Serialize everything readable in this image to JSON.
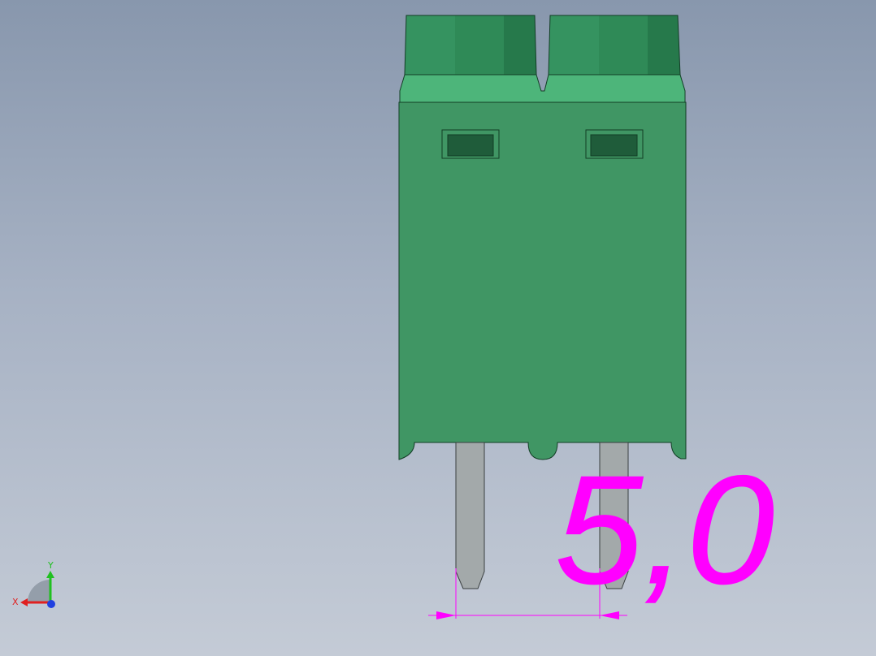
{
  "viewport": {
    "background_top": "#8897ad",
    "background_bottom": "#c4cbd6"
  },
  "model": {
    "body_color": "#409664",
    "cap_color": "#2f8a57",
    "cap_shoulder_color": "#4db57a",
    "window_color": "#1f5c3a",
    "pin_color": "#a3a9aa",
    "pin_count": 2
  },
  "dimension": {
    "value_text": "5,0",
    "color": "#ff00ff"
  },
  "triad": {
    "x_label": "X",
    "y_label": "Y",
    "x_color": "#e02020",
    "y_color": "#20c020",
    "z_color": "#2040e0"
  }
}
